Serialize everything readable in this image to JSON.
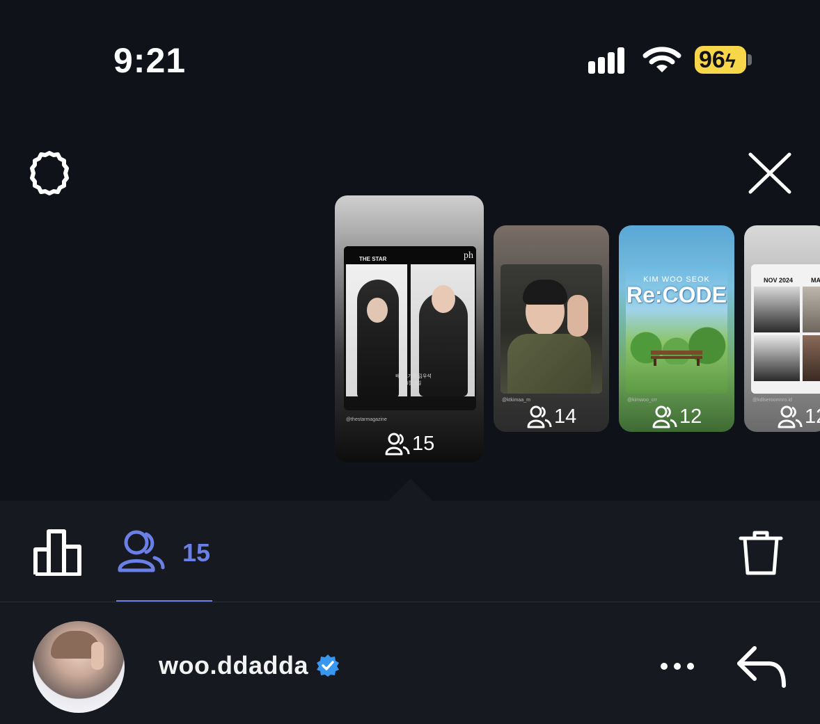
{
  "status_bar": {
    "time": "9:21",
    "battery": "96",
    "icons": [
      "cellular-signal-icon",
      "wifi-icon",
      "battery-charging-icon"
    ]
  },
  "top_actions": {
    "settings_icon": "gear-icon",
    "close_icon": "close-icon"
  },
  "stories": [
    {
      "handle": "@thestarmagazine",
      "viewers": "15",
      "magazine_title": "THE STAR",
      "magazine_mark": "ph",
      "caption": "배우&가수 김우석\n5월 3일",
      "selected": true
    },
    {
      "handle": "@ktkimaa_m",
      "viewers": "14"
    },
    {
      "handle": "@kimwoo_crr",
      "viewers": "12",
      "poster_subtitle": "KIM WOO SEOK",
      "poster_title": "Re:CODE"
    },
    {
      "handle": "@kdlseroomnro.id",
      "viewers": "12",
      "poster_header_left": "NOV 2024",
      "poster_header_right": "MA"
    }
  ],
  "activity_tabs": {
    "insights_icon": "bar-chart-icon",
    "viewers_icon": "viewers-icon",
    "viewers_count": "15",
    "delete_icon": "trash-icon",
    "accent_color": "#6b80e6"
  },
  "viewer_row": {
    "username": "woo.ddadda",
    "verified": true,
    "verified_color": "#3897f0",
    "more_icon": "more-dots-icon",
    "reply_icon": "reply-arrow-icon"
  }
}
